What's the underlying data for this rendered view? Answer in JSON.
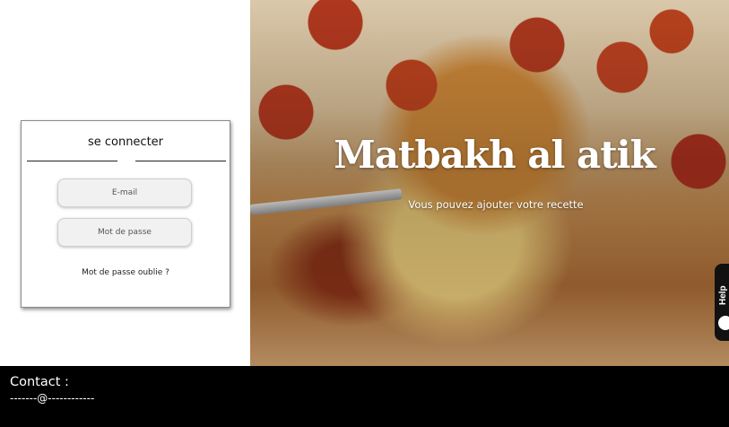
{
  "login": {
    "title": "se connecter",
    "email_placeholder": "E-mail",
    "password_placeholder": "Mot de passe",
    "forgot_password": "Mot de passe oublie ?"
  },
  "hero": {
    "title": "Matbakh al atik",
    "subtitle": "Vous pouvez ajouter votre recette"
  },
  "help_widget": {
    "label": "Help"
  },
  "footer": {
    "contact_label": "Contact :",
    "contact_value": "-------@------------"
  }
}
